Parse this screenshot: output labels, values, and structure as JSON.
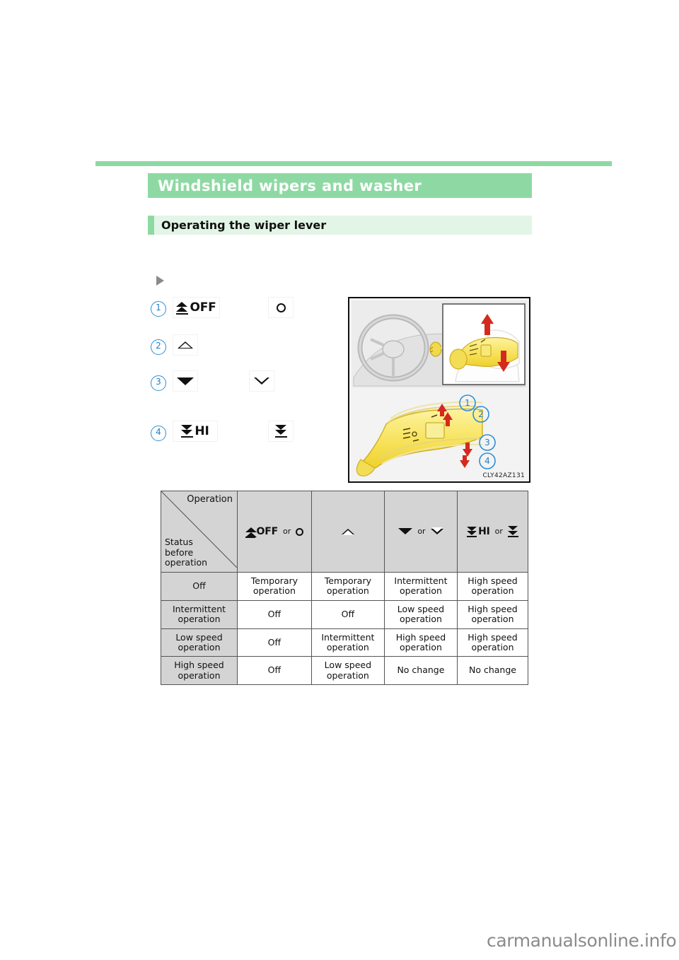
{
  "document": {
    "section_title": "Windshield wipers and washer",
    "subsection_title": "Operating the wiper lever",
    "watermark": "carmanualsonline.info"
  },
  "lever_positions": {
    "bullet_icon": "play-triangle-icon",
    "items": [
      {
        "number": "1",
        "primary_label": "OFF",
        "primary_icon": "wiper-off-icon",
        "alt_icon": "circle-icon",
        "alt_label": "o"
      },
      {
        "number": "2",
        "primary_label": "",
        "primary_icon": "triangle-up-outline-icon",
        "alt_icon": "",
        "alt_label": ""
      },
      {
        "number": "3",
        "primary_label": "",
        "primary_icon": "triangle-down-solid-icon",
        "alt_icon": "triangle-down-outline-icon",
        "alt_label": ""
      },
      {
        "number": "4",
        "primary_label": "HI",
        "primary_icon": "wiper-hi-icon",
        "alt_icon": "double-chevron-down-icon",
        "alt_label": ""
      }
    ]
  },
  "illustration": {
    "caption": "CLY42AZ131",
    "callouts": [
      "1",
      "2",
      "3",
      "4"
    ],
    "alt": "Steering column wiper lever with up and down movement arrows"
  },
  "operation_table": {
    "corner": {
      "column_axis_label": "Operation",
      "row_axis_label": "Status\nbefore\noperation",
      "row_axis_line1": "Status",
      "row_axis_line2": "before",
      "row_axis_line3": "operation"
    },
    "columns": [
      {
        "label": "OFF",
        "icon": "wiper-off-icon",
        "or": "or",
        "alt_icon": "circle-icon",
        "alt_label": "o"
      },
      {
        "label": "",
        "icon": "triangle-up-outline-icon",
        "or": "",
        "alt_icon": "",
        "alt_label": ""
      },
      {
        "label": "",
        "icon": "triangle-down-solid-icon",
        "or": "or",
        "alt_icon": "triangle-down-outline-icon",
        "alt_label": ""
      },
      {
        "label": "HI",
        "icon": "wiper-hi-icon",
        "or": "or",
        "alt_icon": "double-chevron-down-icon",
        "alt_label": ""
      }
    ],
    "rows": [
      {
        "status": "Off",
        "cells": [
          "Temporary operation",
          "Temporary operation",
          "Intermittent operation",
          "High speed operation"
        ]
      },
      {
        "status": "Intermittent operation",
        "cells": [
          "Off",
          "Off",
          "Low speed operation",
          "High speed operation"
        ]
      },
      {
        "status": "Low speed operation",
        "cells": [
          "Off",
          "Intermittent operation",
          "High speed operation",
          "High speed operation"
        ]
      },
      {
        "status": "High speed operation",
        "cells": [
          "Off",
          "Low speed operation",
          "No change",
          "No change"
        ]
      }
    ]
  },
  "colors": {
    "header_green": "#8ed9a3",
    "subheader_green": "#e2f5e6",
    "callout_blue": "#2b8fd6",
    "table_header_gray": "#d4d4d4",
    "illustration_yellow": "#f5e04f",
    "arrow_red": "#d42a1e"
  }
}
